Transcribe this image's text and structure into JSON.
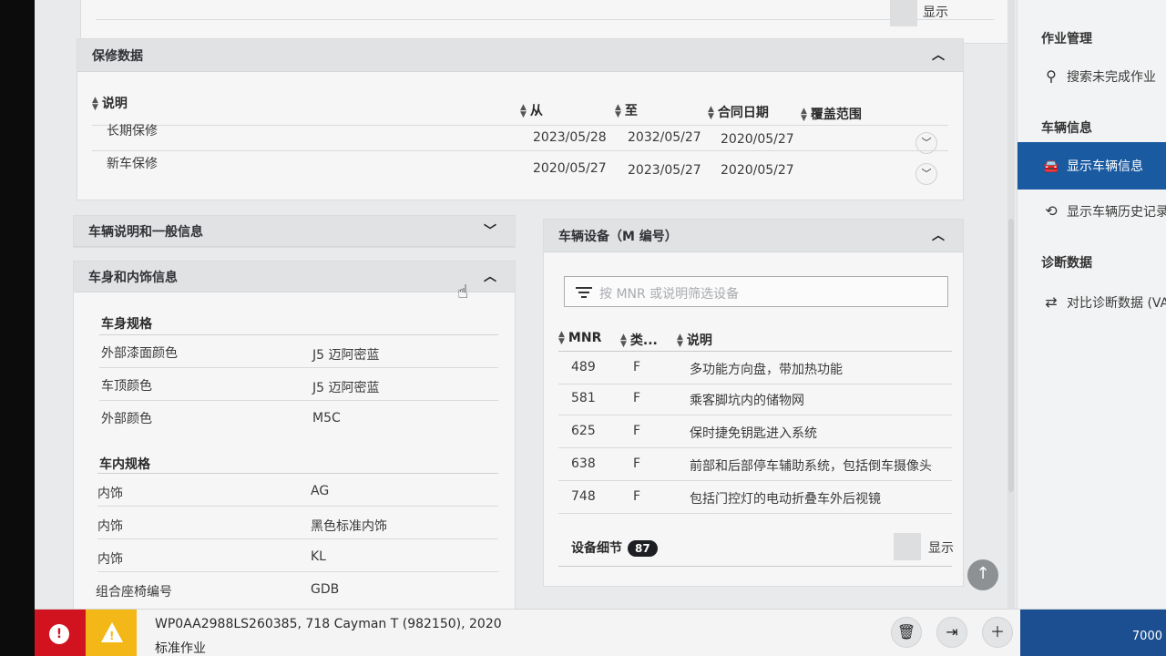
{
  "top_cut": {
    "show_label": "显示"
  },
  "warranty": {
    "title": "保修数据",
    "columns": [
      "说明",
      "从",
      "至",
      "合同日期",
      "覆盖范围"
    ],
    "rows": [
      {
        "desc": "长期保修",
        "from": "2023/05/28",
        "to": "2032/05/27",
        "contract": "2020/05/27"
      },
      {
        "desc": "新车保修",
        "from": "2020/05/27",
        "to": "2023/05/27",
        "contract": "2020/05/27"
      }
    ]
  },
  "vehicle_general": {
    "title": "车辆说明和一般信息"
  },
  "body_interior": {
    "title": "车身和内饰信息",
    "body_spec": {
      "heading": "车身规格",
      "rows": [
        {
          "label": "外部漆面颜色",
          "value": "J5 迈阿密蓝"
        },
        {
          "label": "车顶颜色",
          "value": "J5 迈阿密蓝"
        },
        {
          "label": "外部颜色",
          "value": "M5C"
        }
      ]
    },
    "interior_spec": {
      "heading": "车内规格",
      "rows": [
        {
          "label": "内饰",
          "value": "AG"
        },
        {
          "label": "内饰",
          "value": "黑色标准内饰"
        },
        {
          "label": "内饰",
          "value": "KL"
        },
        {
          "label": "组合座椅编号",
          "value": "GDB"
        }
      ]
    }
  },
  "equipment": {
    "title": "车辆设备（M 编号）",
    "filter_placeholder": "按 MNR 或说明筛选设备",
    "columns": [
      "MNR",
      "类...",
      "说明"
    ],
    "rows": [
      {
        "mnr": "489",
        "type": "F",
        "desc": "多功能方向盘，带加热功能"
      },
      {
        "mnr": "581",
        "type": "F",
        "desc": "乘客脚坑内的储物网"
      },
      {
        "mnr": "625",
        "type": "F",
        "desc": "保时捷免钥匙进入系统"
      },
      {
        "mnr": "638",
        "type": "F",
        "desc": "前部和后部停车辅助系统，包括倒车摄像头"
      },
      {
        "mnr": "748",
        "type": "F",
        "desc": "包括门控灯的电动折叠车外后视镜"
      }
    ],
    "details_label": "设备细节",
    "details_count": "87",
    "show_label": "显示"
  },
  "sidebar": {
    "job_mgmt": "作业管理",
    "search_jobs": "搜索未完成作业",
    "vehicle_info": "车辆信息",
    "show_vehicle_info": "显示车辆信息",
    "show_vehicle_history": "显示车辆历史记录",
    "diagnostic_data": "诊断数据",
    "compare_diag": "对比诊断数据 (VA"
  },
  "bottom_bar": {
    "vehicle": "WP0AA2988LS260385, 718 Cayman T (982150), 2020",
    "job": "标准作业",
    "right_number": "7000"
  }
}
